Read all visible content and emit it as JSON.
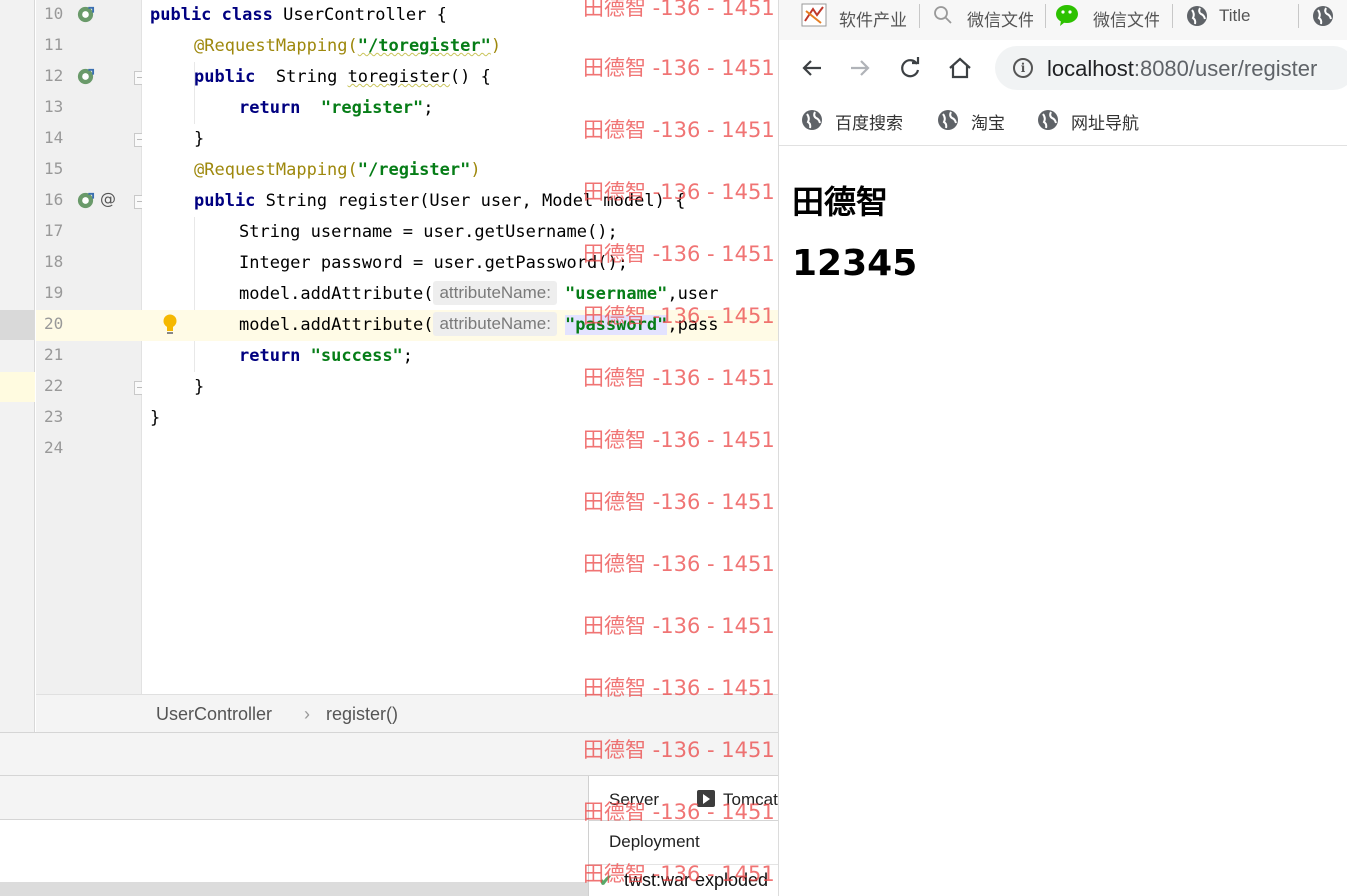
{
  "ide": {
    "line_numbers": [
      "10",
      "11",
      "12",
      "13",
      "14",
      "15",
      "16",
      "17",
      "18",
      "19",
      "20",
      "21",
      "22",
      "23",
      "24"
    ],
    "code": {
      "l10": {
        "kw1": "public",
        "kw2": "class",
        "rest": "UserController {"
      },
      "l11": {
        "ann": "@RequestMapping(",
        "str": "\"/toregister\"",
        "close": ")"
      },
      "l12": {
        "kw": "public",
        "rest1": "String ",
        "name": "toregister",
        "rest2": "() {"
      },
      "l13": {
        "kw": "return",
        "str": "\"register\"",
        "end": ";"
      },
      "l14": {
        "text": "}"
      },
      "l15": {
        "ann": "@RequestMapping(",
        "str": "\"/register\"",
        "close": ")"
      },
      "l16": {
        "kw": "public",
        "rest": "String register(User user, Model model) {"
      },
      "l17": {
        "text": "String username = user.getUsername();"
      },
      "l18": {
        "text": "Integer password = user.getPassword();"
      },
      "l19": {
        "call": "model.addAttribute(",
        "hint": "attributeName:",
        "str": "\"username\"",
        "rest": ",user"
      },
      "l20": {
        "call": "model.addAttribute(",
        "hint": "attributeName:",
        "str": "\"password\"",
        "rest": ",pass"
      },
      "l21": {
        "kw": "return",
        "str": "\"success\"",
        "end": ";"
      },
      "l22": {
        "text": "}"
      },
      "l23": {
        "text": "}"
      }
    },
    "gutter_at_symbol": "@",
    "breadcrumb": {
      "class": "UserController",
      "separator": "›",
      "method": "register()"
    },
    "run_panel": {
      "tab_server": "Server",
      "tab_tomcat": "Tomcat",
      "deployment_label": "Deployment",
      "artifact": "twst:war exploded",
      "check_icon": "check-icon"
    }
  },
  "browser": {
    "tabs": [
      {
        "label": "软件产业",
        "icon": "software-site-icon"
      },
      {
        "label": "微信文件",
        "icon": "search-icon"
      },
      {
        "label": "微信文件",
        "icon": "wechat-icon"
      },
      {
        "label": "Title",
        "icon": "globe-icon"
      },
      {
        "label": "",
        "icon": "globe-icon"
      }
    ],
    "address": {
      "host": "localhost",
      "path": ":8080/user/register"
    },
    "bookmarks": [
      {
        "label": "百度搜索",
        "icon": "globe-icon"
      },
      {
        "label": "淘宝",
        "icon": "globe-icon"
      },
      {
        "label": "网址导航",
        "icon": "globe-icon"
      }
    ],
    "page": {
      "heading_name": "田德智",
      "heading_password": "12345"
    }
  },
  "watermark": {
    "text": "田德智 -136 - 1451",
    "color": "#eb4646"
  }
}
